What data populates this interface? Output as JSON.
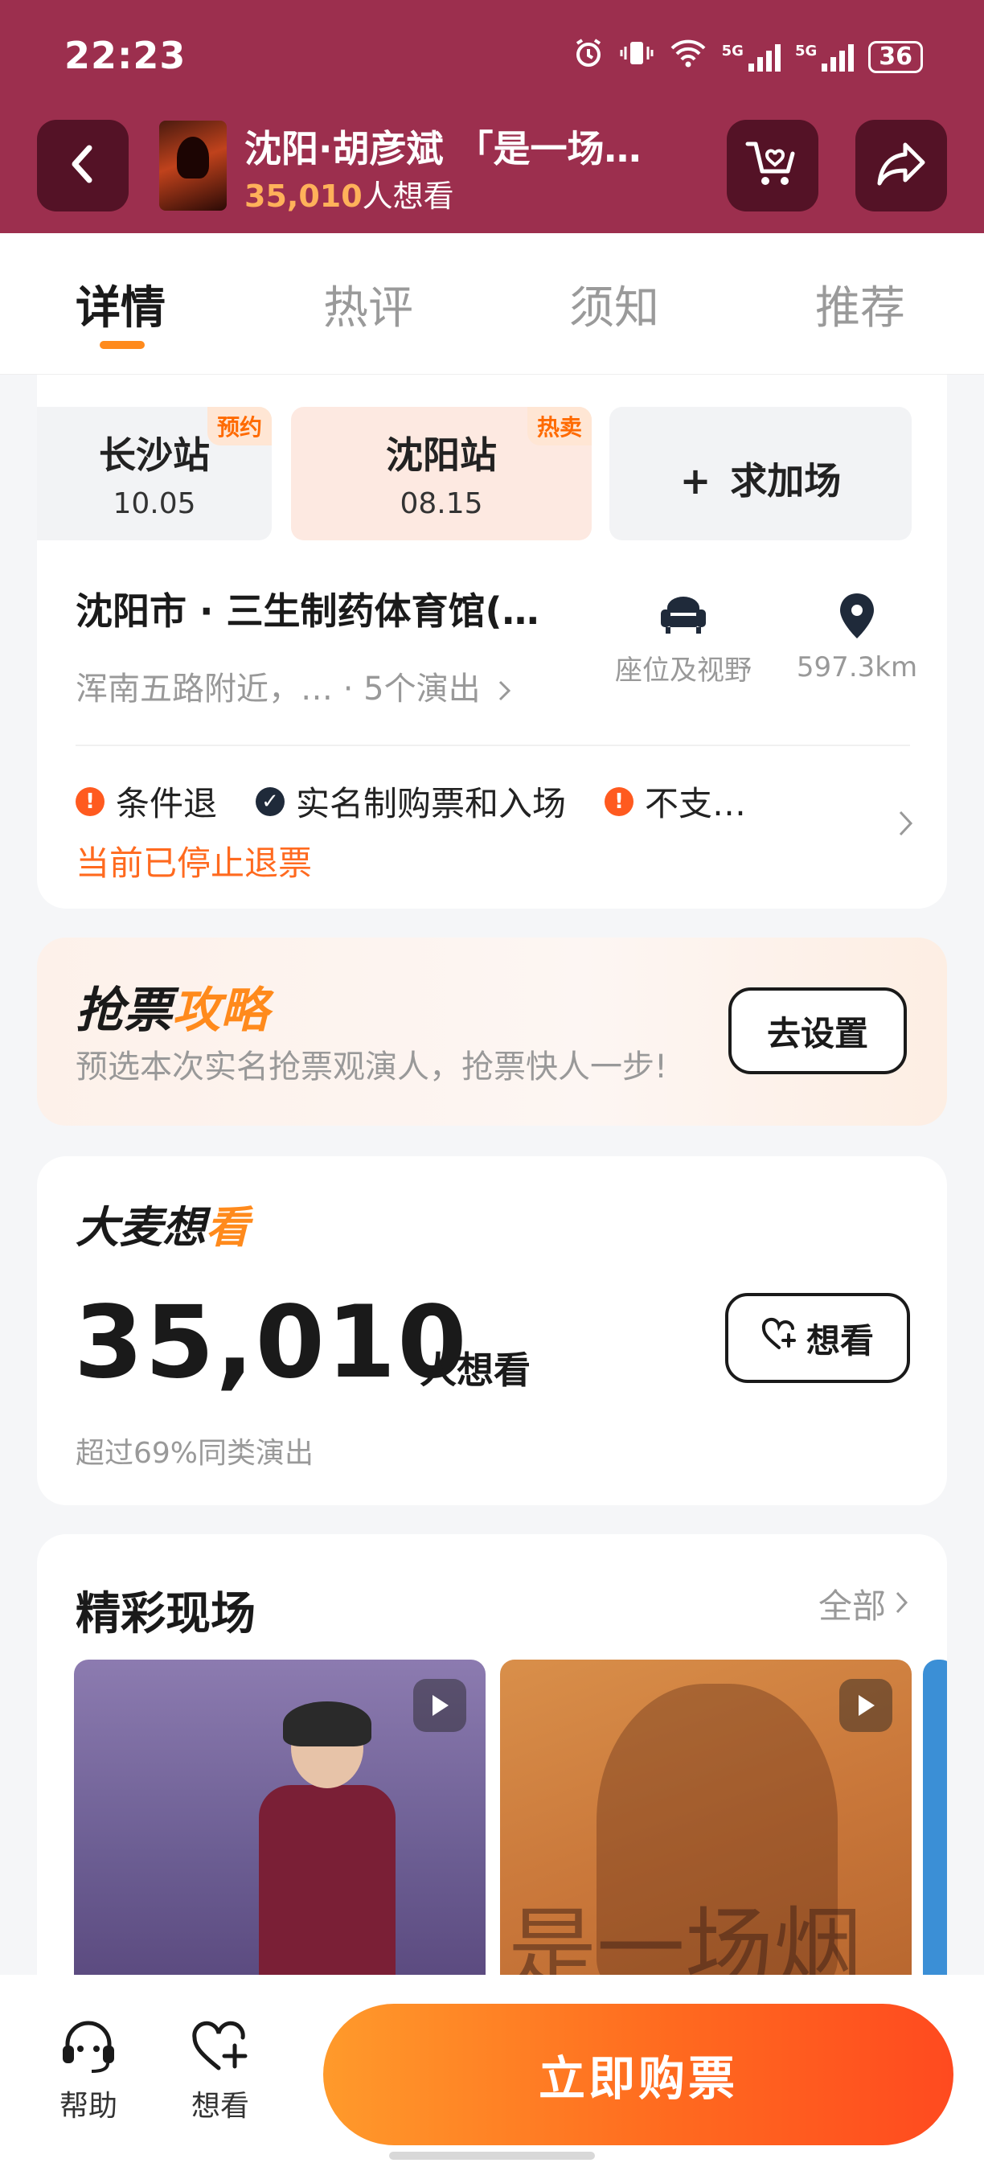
{
  "status_bar": {
    "time": "22:23",
    "battery": "36",
    "network_1": "5G",
    "network_2": "5G"
  },
  "header": {
    "title": "沈阳·胡彦斌 「是一场…",
    "want_count": "35,010",
    "want_suffix": "人想看",
    "icons": [
      "back-icon",
      "cart-heart-icon",
      "share-icon"
    ]
  },
  "tabs": [
    {
      "label": "详情",
      "active": true
    },
    {
      "label": "热评",
      "active": false
    },
    {
      "label": "须知",
      "active": false
    },
    {
      "label": "推荐",
      "active": false
    }
  ],
  "sessions": [
    {
      "name": "长沙站",
      "date": "10.05",
      "tag": "预约"
    },
    {
      "name": "沈阳站",
      "date": "08.15",
      "tag": "热卖",
      "selected": true
    },
    {
      "name": "求加场",
      "prefix": "+"
    }
  ],
  "venue": {
    "name": "沈阳市 · 三生制药体育馆(…",
    "address": "浑南五路附近，… · 5个演出",
    "seat_label": "座位及视野",
    "distance": "597.3km"
  },
  "policies": [
    {
      "label": "条件退",
      "icon": "warning-icon"
    },
    {
      "label": "实名制购票和入场",
      "icon": "check-icon"
    },
    {
      "label": "不支…",
      "icon": "warning-icon"
    }
  ],
  "refund_note": "当前已停止退票",
  "strategy": {
    "title_a": "抢票",
    "title_b": "攻略",
    "subtitle": "预选本次实名抢票观演人，抢票快人一步!",
    "button": "去设置"
  },
  "want_section": {
    "brand_a": "大麦想",
    "brand_b": "看",
    "count": "35,010",
    "unit": "人想看",
    "note": "超过69%同类演出",
    "button": "想看"
  },
  "live_section": {
    "title": "精彩现场",
    "all_label": "全部",
    "thumb_text": "是一场烟"
  },
  "bottom_bar": {
    "help_label": "帮助",
    "want_label": "想看",
    "buy_label": "立即购票"
  },
  "colors": {
    "header_bg": "#9c2f4e",
    "accent_orange": "#ff8a1c",
    "buy_gradient_start": "#ff9a2b",
    "buy_gradient_end": "#ff4a1f"
  }
}
